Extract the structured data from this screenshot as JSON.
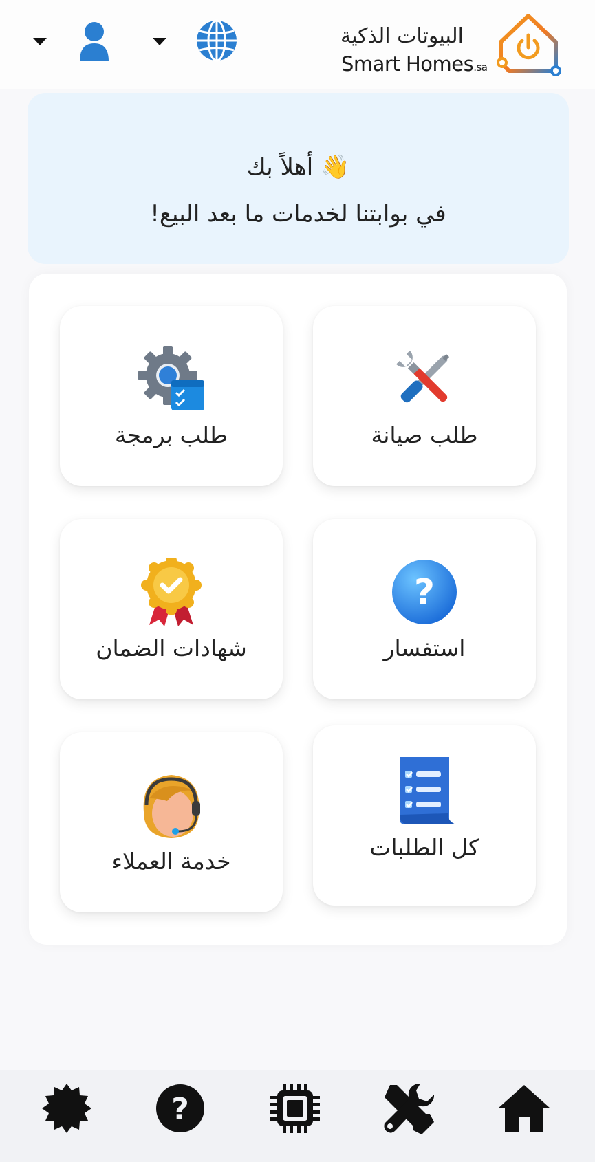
{
  "header": {
    "logo_ar": "البيوتات الذكية",
    "logo_en": "Smart Homes",
    "logo_en_suffix": ".sa",
    "language_icon": "globe-icon",
    "account_icon": "user-icon"
  },
  "welcome": {
    "greeting": "👋 أهلاً بك",
    "message": "في بوابتنا لخدمات ما بعد البيع!"
  },
  "tiles": [
    {
      "label": "طلب صيانة",
      "icon": "tools-icon"
    },
    {
      "label": "طلب برمجة",
      "icon": "settings-gear-icon"
    },
    {
      "label": "استفسار",
      "icon": "question-icon"
    },
    {
      "label": "شهادات الضمان",
      "icon": "certificate-badge-icon"
    },
    {
      "label": "كل الطلبات",
      "icon": "checklist-icon"
    },
    {
      "label": "خدمة العملاء",
      "icon": "customer-support-icon"
    }
  ],
  "bottom_nav": [
    {
      "icon": "home-icon"
    },
    {
      "icon": "tools-icon"
    },
    {
      "icon": "chip-icon"
    },
    {
      "icon": "help-icon"
    },
    {
      "icon": "badge-icon"
    }
  ],
  "colors": {
    "brand_blue": "#2b7fd1",
    "brand_orange": "#f29b1f",
    "welcome_bg": "#e9f4fd",
    "nav_bg": "#f1f2f5"
  }
}
